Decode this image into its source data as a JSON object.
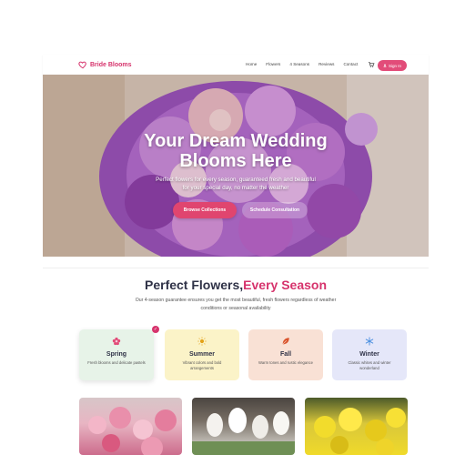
{
  "brand": {
    "name": "Bride Blooms",
    "icon": "heart-icon",
    "color": "#d6336c"
  },
  "nav": {
    "links": [
      "Home",
      "Flowers",
      "4 Seasons",
      "Reviews",
      "Contact"
    ],
    "cart_icon": "cart-icon",
    "signin_label": "Sign In"
  },
  "hero": {
    "title_line1": "Your Dream Wedding",
    "title_line2": "Blooms Here",
    "subtitle": "Perfect flowers for every season, guaranteed fresh and beautiful for your special day, no matter the weather",
    "browse_label": "Browse Collections",
    "schedule_label": "Schedule Consultation"
  },
  "section": {
    "title_part1": "Perfect Flowers,",
    "title_part2": "Every Season",
    "description": "Our 4-season guarantee ensures you get the most beautiful, fresh flowers regardless of weather conditions or seasonal availability"
  },
  "seasons": [
    {
      "name": "Spring",
      "desc": "Fresh blooms and delicate pastels",
      "icon": "flower-icon",
      "color": "#e24c79"
    },
    {
      "name": "Summer",
      "desc": "Vibrant colors and bold arrangements",
      "icon": "sun-icon",
      "color": "#e3a21a"
    },
    {
      "name": "Fall",
      "desc": "Warm tones and rustic elegance",
      "icon": "leaf-icon",
      "color": "#d9532b"
    },
    {
      "name": "Winter",
      "desc": "Classic whites and winter wonderland",
      "icon": "snowflake-icon",
      "color": "#4a8fe0"
    }
  ],
  "colors": {
    "accent": "#e24c79",
    "heading": "#2f3247"
  }
}
